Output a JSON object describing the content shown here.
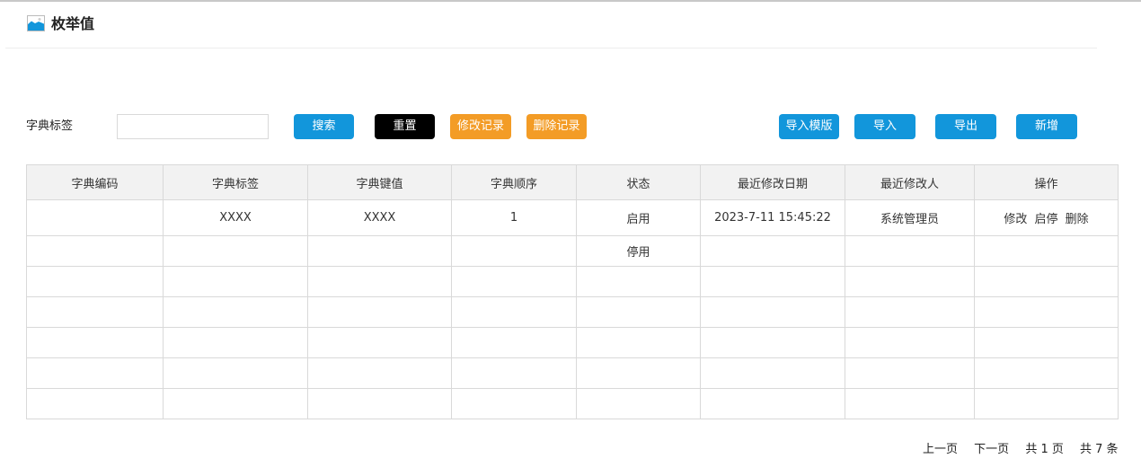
{
  "header": {
    "title": "枚举值",
    "icon": "image-icon"
  },
  "search": {
    "label": "字典标签",
    "value": "",
    "placeholder": ""
  },
  "toolbar": {
    "search_label": "搜索",
    "reset_label": "重置",
    "modify_log_label": "修改记录",
    "delete_log_label": "删除记录",
    "import_template_label": "导入模版",
    "import_label": "导入",
    "export_label": "导出",
    "add_label": "新增"
  },
  "colors": {
    "primary": "#1296db",
    "dark": "#000000",
    "warning": "#f39c26"
  },
  "table": {
    "columns": [
      "字典编码",
      "字典标签",
      "字典键值",
      "字典顺序",
      "状态",
      "最近修改日期",
      "最近修改人",
      "操作"
    ],
    "rows": [
      {
        "code": "",
        "label": "XXXX",
        "value": "XXXX",
        "order": "1",
        "status": "启用",
        "modified_date": "2023-7-11 15:45:22",
        "modified_by": "系统管理员",
        "actions": [
          "修改",
          "启停",
          "删除"
        ]
      },
      {
        "code": "",
        "label": "",
        "value": "",
        "order": "",
        "status": "停用",
        "modified_date": "",
        "modified_by": "",
        "actions": []
      }
    ]
  },
  "pagination": {
    "prev": "上一页",
    "next": "下一页",
    "total_pages": "共 1 页",
    "total_items": "共 7 条"
  }
}
